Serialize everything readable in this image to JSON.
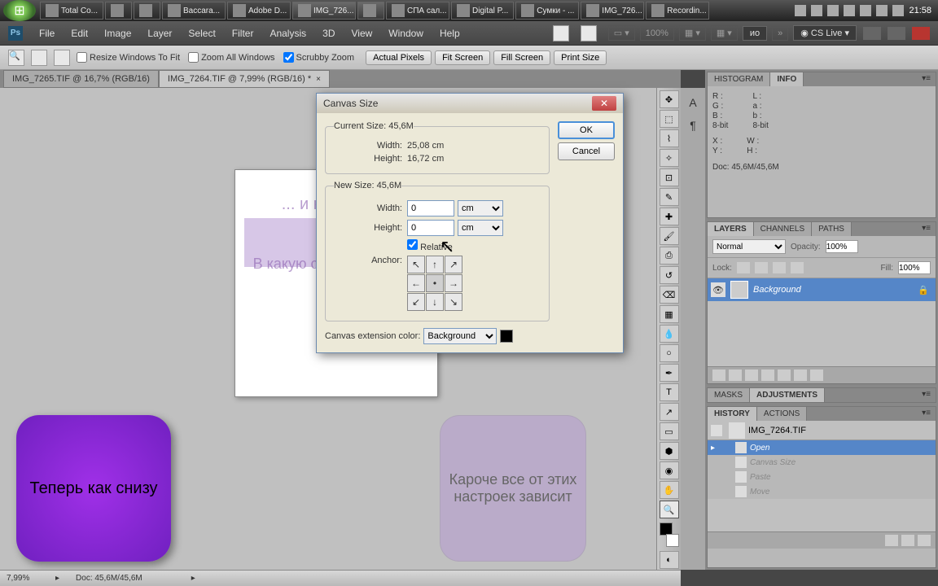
{
  "taskbar": {
    "items": [
      {
        "label": "Total Co..."
      },
      {
        "label": ""
      },
      {
        "label": ""
      },
      {
        "label": "Baccara..."
      },
      {
        "label": "Adobe D..."
      },
      {
        "label": "IMG_726..."
      },
      {
        "label": ""
      },
      {
        "label": "СПА сал..."
      },
      {
        "label": "Digital P..."
      },
      {
        "label": "Сумки - ..."
      },
      {
        "label": "IMG_726..."
      },
      {
        "label": "Recordin..."
      }
    ],
    "clock": "21:58"
  },
  "menu": {
    "items": [
      "File",
      "Edit",
      "Image",
      "Layer",
      "Select",
      "Filter",
      "Analysis",
      "3D",
      "View",
      "Window",
      "Help"
    ],
    "zoom": "100%",
    "cslive": "CS Live"
  },
  "options": {
    "resize_windows": "Resize Windows To Fit",
    "zoom_all": "Zoom All Windows",
    "scrubby": "Scrubby Zoom",
    "btns": [
      "Actual Pixels",
      "Fit Screen",
      "Fill Screen",
      "Print Size"
    ]
  },
  "tabs": [
    {
      "label": "IMG_7265.TIF @ 16,7% (RGB/16)"
    },
    {
      "label": "IMG_7264.TIF @ 7,99% (RGB/16) *",
      "active": true
    }
  ],
  "dialog": {
    "title": "Canvas Size",
    "ok": "OK",
    "cancel": "Cancel",
    "current_size_label": "Current Size: 45,6M",
    "cur_width_label": "Width:",
    "cur_width_val": "25,08 cm",
    "cur_height_label": "Height:",
    "cur_height_val": "16,72 cm",
    "new_size_label": "New Size: 45,6M",
    "width_label": "Width:",
    "width_val": "0",
    "width_unit": "cm",
    "height_label": "Height:",
    "height_val": "0",
    "height_unit": "cm",
    "relative": "Relative",
    "anchor": "Anchor:",
    "ext_color_label": "Canvas extension color:",
    "ext_color_val": "Background",
    "swatch": "#000000"
  },
  "overlays": {
    "arrow_line1": "... и на сколько",
    "arrow_line2": "В какую сторону граница",
    "box1": "Теперь как снизу",
    "box2": "Кароче все от этих настроек зависит"
  },
  "panels": {
    "histogram": "HISTOGRAM",
    "info": "INFO",
    "info_data": {
      "r": "R :",
      "g": "G :",
      "b": "B :",
      "l": "L :",
      "a": "a :",
      "b2": "b :",
      "bit1": "8-bit",
      "bit2": "8-bit",
      "x": "X :",
      "y": "Y :",
      "w": "W :",
      "h": "H :",
      "doc": "Doc: 45,6M/45,6M"
    },
    "layers": "LAYERS",
    "channels": "CHANNELS",
    "paths": "PATHS",
    "blend": "Normal",
    "opacity_label": "Opacity:",
    "opacity": "100%",
    "fill_label": "Fill:",
    "fill": "100%",
    "lock_label": "Lock:",
    "layer_name": "Background",
    "masks": "MASKS",
    "adjustments": "ADJUSTMENTS",
    "history": "HISTORY",
    "actions": "ACTIONS",
    "hist_doc": "IMG_7264.TIF",
    "hist_items": [
      {
        "label": "Open",
        "active": true
      },
      {
        "label": "Canvas Size",
        "dim": true
      },
      {
        "label": "Paste",
        "dim": true
      },
      {
        "label": "Move",
        "dim": true
      }
    ]
  },
  "status": {
    "zoom": "7,99%",
    "doc": "Doc: 45,6M/45,6M"
  }
}
